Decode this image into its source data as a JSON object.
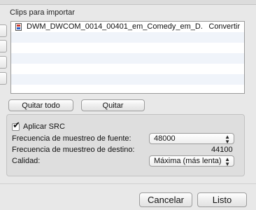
{
  "section_label": "Clips para importar",
  "clips": [
    {
      "filename": "DWM_DWCOM_0014_00401_em_Comedy_em_D...",
      "status": "Convertir"
    },
    {
      "filename": "",
      "status": ""
    },
    {
      "filename": "",
      "status": ""
    },
    {
      "filename": "",
      "status": ""
    },
    {
      "filename": "",
      "status": ""
    },
    {
      "filename": "",
      "status": ""
    },
    {
      "filename": "",
      "status": ""
    }
  ],
  "buttons": {
    "remove_all": "Quitar todo",
    "remove": "Quitar",
    "cancel": "Cancelar",
    "done": "Listo"
  },
  "src": {
    "checkbox_label": "Aplicar SRC",
    "checked": true,
    "source_rate_label": "Frecuencia de muestreo de fuente:",
    "source_rate_value": "48000",
    "dest_rate_label": "Frecuencia de muestreo de destino:",
    "dest_rate_value": "44100",
    "quality_label": "Calidad:",
    "quality_value": "Máxima (más lenta)"
  },
  "icons": {
    "check": "checkmark",
    "popup_arrows": "up-down-arrows",
    "file": "document-icon"
  }
}
